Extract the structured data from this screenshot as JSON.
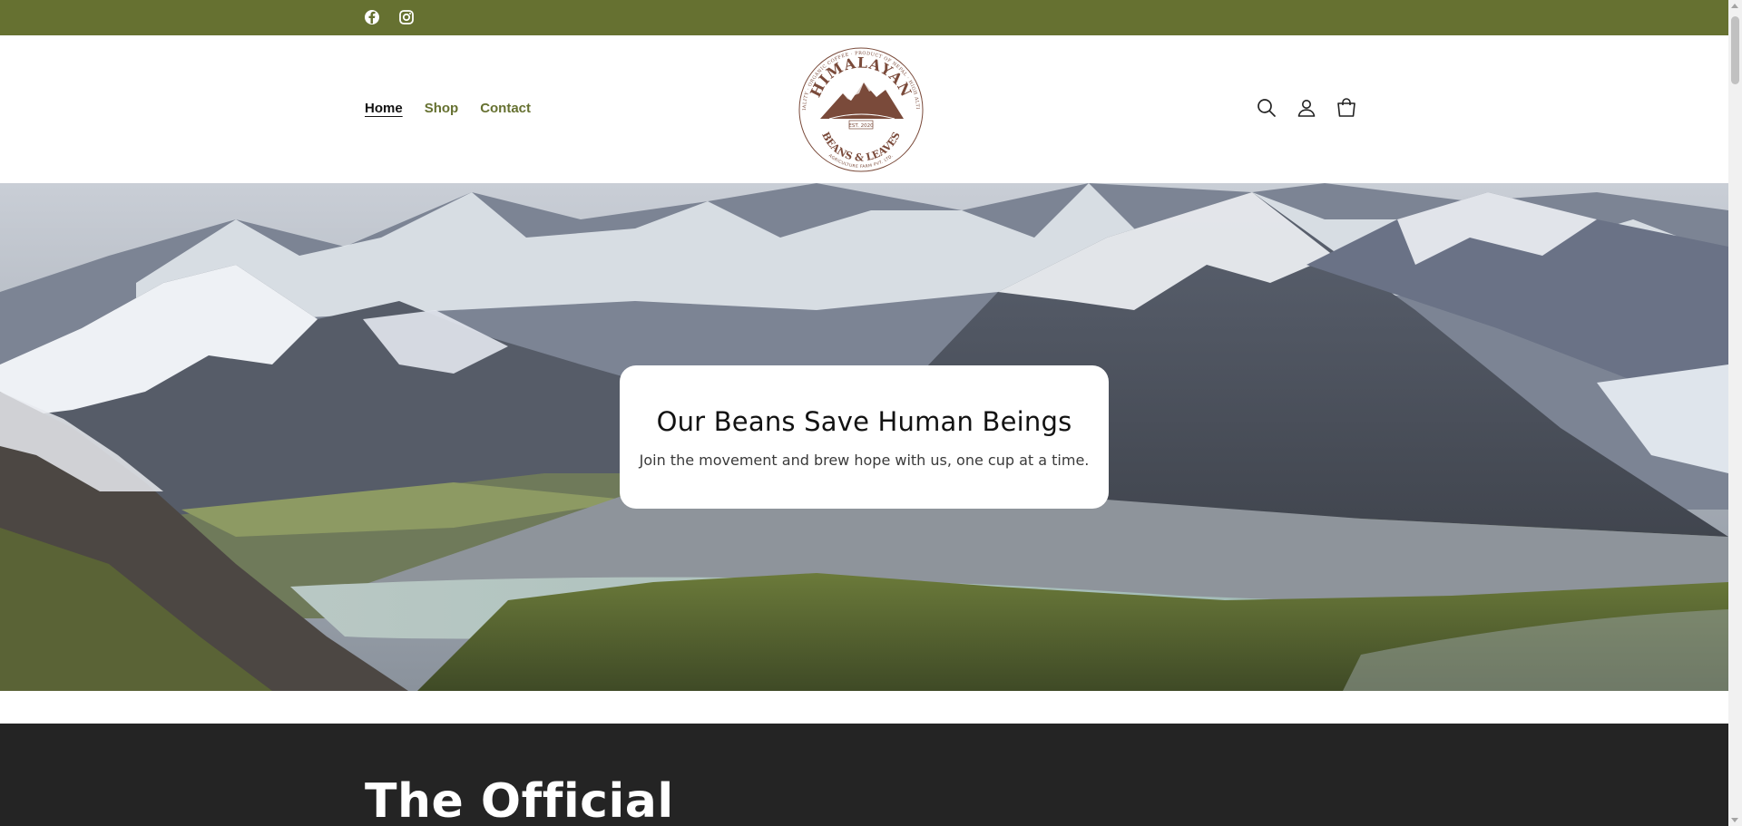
{
  "colors": {
    "announcement_bg": "#667131",
    "nav_link": "#667131",
    "dark_section_bg": "#242424",
    "logo_brown": "#7a4a3a"
  },
  "announcement_bar": {
    "icons": [
      "facebook-icon",
      "instagram-icon"
    ]
  },
  "header": {
    "nav": [
      {
        "label": "Home",
        "active": true
      },
      {
        "label": "Shop",
        "active": false
      },
      {
        "label": "Contact",
        "active": false
      }
    ],
    "logo": {
      "arc_top": "HIMALAYAN",
      "arc_bottom": "BEANS & LEAVES",
      "badge": "EST. 2020",
      "arc_outer": "SPECIALITY · ORGANIC COFFEE · PRODUCT OF NEPAL · HIGH ALTITUDE",
      "arc_footer": "AGRICULTURE FARM PVT. LTD."
    },
    "icons": [
      "search-icon",
      "account-icon",
      "cart-icon"
    ]
  },
  "hero": {
    "title": "Our Beans Save Human Beings",
    "subtitle": "Join the movement and brew hope with us, one cup at a time."
  },
  "section": {
    "title": "The Official"
  }
}
